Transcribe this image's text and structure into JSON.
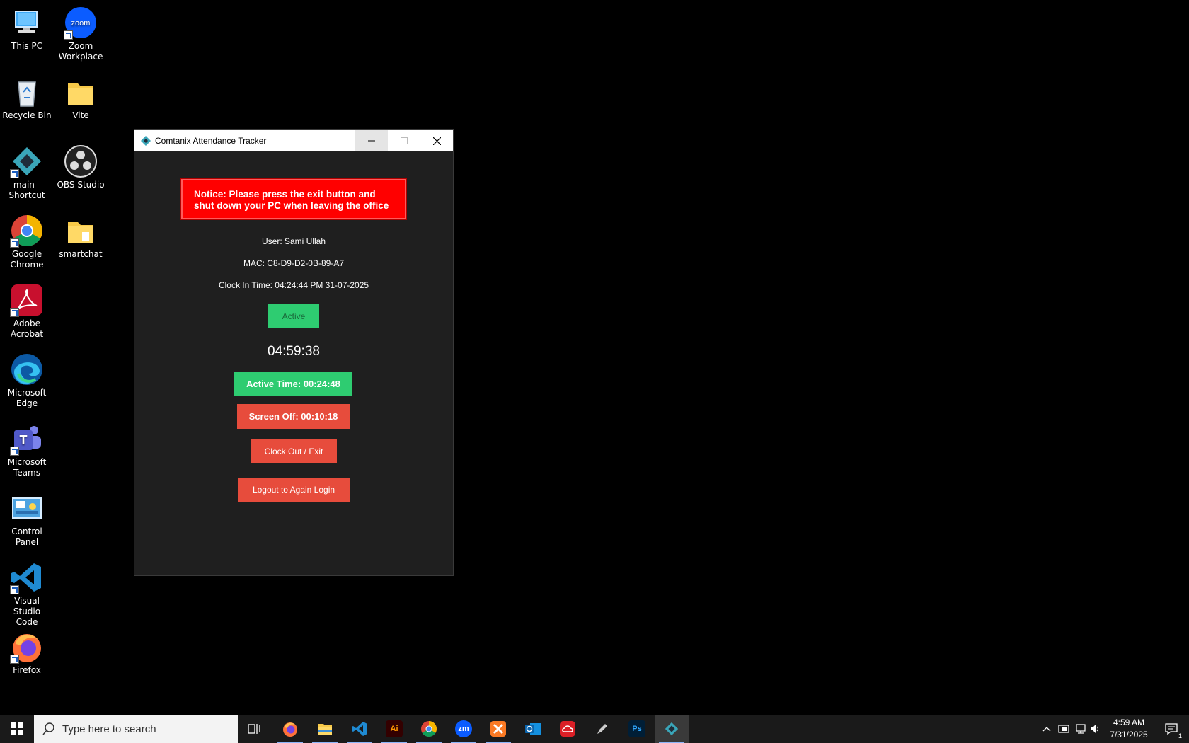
{
  "desktop": {
    "icons": [
      {
        "label_1": "This PC",
        "label_2": ""
      },
      {
        "label_1": "Zoom",
        "label_2": "Workplace"
      },
      {
        "label_1": "Recycle Bin",
        "label_2": ""
      },
      {
        "label_1": "Vite",
        "label_2": ""
      },
      {
        "label_1": "main -",
        "label_2": "Shortcut"
      },
      {
        "label_1": "OBS Studio",
        "label_2": ""
      },
      {
        "label_1": "Google",
        "label_2": "Chrome"
      },
      {
        "label_1": "smartchat",
        "label_2": ""
      },
      {
        "label_1": "Adobe",
        "label_2": "Acrobat"
      },
      {
        "label_1": "Microsoft",
        "label_2": "Edge"
      },
      {
        "label_1": "Microsoft",
        "label_2": "Teams"
      },
      {
        "label_1": "Control Panel",
        "label_2": ""
      },
      {
        "label_1": "Visual Studio",
        "label_2": "Code"
      },
      {
        "label_1": "Firefox",
        "label_2": ""
      }
    ]
  },
  "window": {
    "title": "Comtanix Attendance Tracker",
    "notice": "Notice: Please press the exit button and shut down your PC when leaving the office",
    "user": "User: Sami Ullah",
    "mac": "MAC: C8-D9-D2-0B-89-A7",
    "clock_in": "Clock In Time: 04:24:44 PM 31-07-2025",
    "status": "Active",
    "current_time": "04:59:38",
    "active_time": "Active Time: 00:24:48",
    "screen_off": "Screen Off: 00:10:18",
    "clock_out_label": "Clock Out / Exit",
    "logout_label": "Logout to Again Login"
  },
  "taskbar": {
    "search_placeholder": "Type here to search",
    "apps": [
      "task-view",
      "firefox",
      "file-explorer",
      "vscode",
      "illustrator",
      "chrome",
      "zoom",
      "xampp",
      "outlook",
      "creative-cloud",
      "pen-tool",
      "photoshop",
      "attendance-tracker"
    ],
    "illustrator_label": "Ai",
    "zoom_label": "zm",
    "photoshop_label": "Ps",
    "time": "4:59 AM",
    "date": "7/31/2025",
    "notification_count": "1"
  },
  "colors": {
    "green": "#2ecc71",
    "red": "#e74c3c",
    "notice_red": "#ff0000",
    "window_bg": "#1f1f1f"
  }
}
